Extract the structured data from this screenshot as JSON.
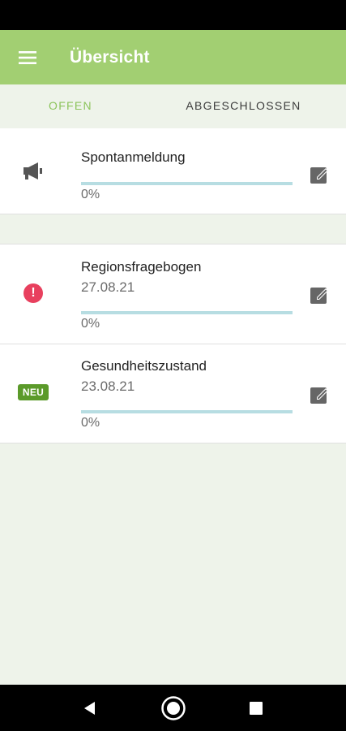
{
  "appbar": {
    "title": "Übersicht",
    "menu_icon": "hamburger-menu-icon",
    "color": "#a2cf72"
  },
  "tabs": [
    {
      "label": "OFFEN",
      "active": true
    },
    {
      "label": "ABGESCHLOSSEN",
      "active": false
    }
  ],
  "items": [
    {
      "name": "Spontanmeldung",
      "date": "",
      "progress_label": "0%",
      "progress": 0,
      "icon": "megaphone-icon"
    },
    {
      "name": "Regionsfragebogen",
      "date": "27.08.21",
      "progress_label": "0%",
      "progress": 0,
      "icon": "alert-icon"
    },
    {
      "name": "Gesundheitszustand",
      "date": "23.08.21",
      "progress_label": "0%",
      "progress": 0,
      "icon": "new-badge",
      "badge": "NEU"
    }
  ],
  "colors": {
    "accent": "#a2cf72",
    "alert": "#e8405e",
    "badge": "#5b9a2a",
    "progress_track": "#b7dde2"
  }
}
